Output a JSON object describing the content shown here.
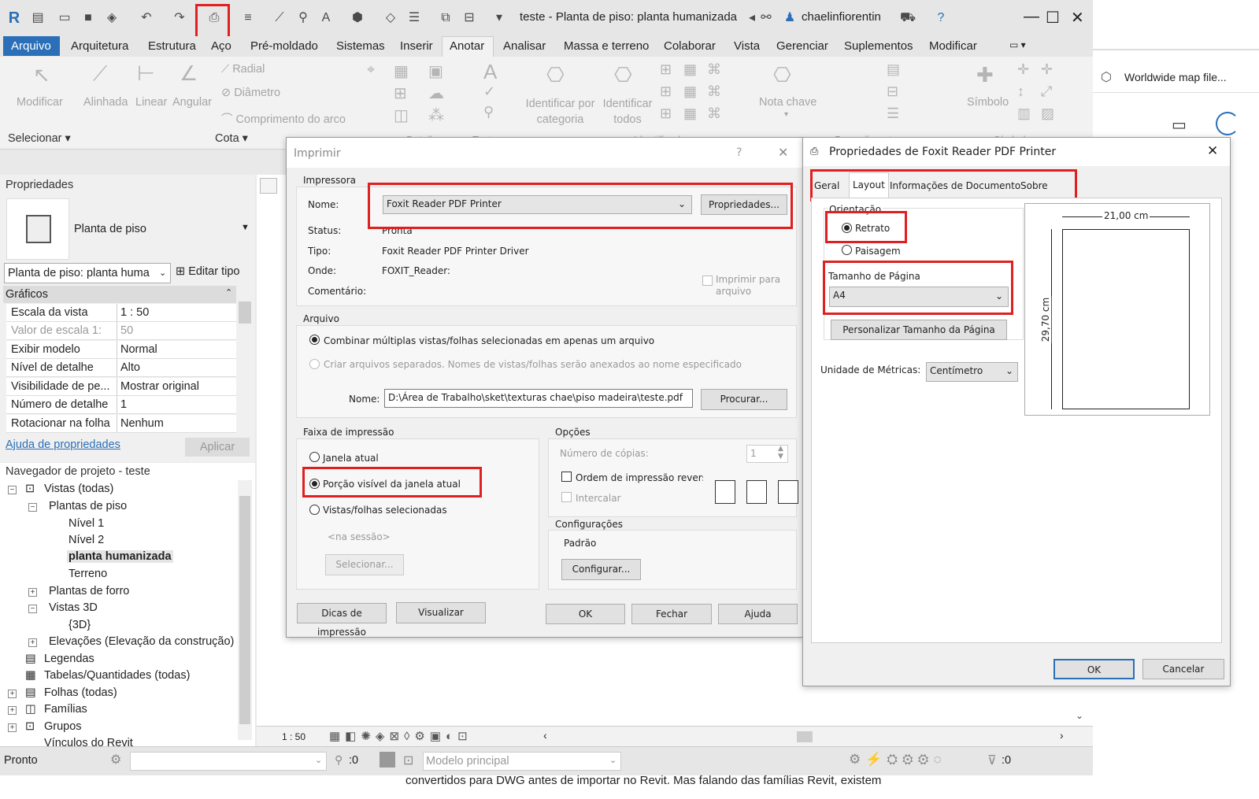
{
  "window": {
    "title": "teste - Planta de piso: planta humanizada",
    "user": "chaelinfiorentin"
  },
  "menu": {
    "items": [
      "Arquivo",
      "Arquitetura",
      "Estrutura",
      "Aço",
      "Pré-moldado",
      "Sistemas",
      "Inserir",
      "Anotar",
      "Analisar",
      "Massa e terreno",
      "Colaborar",
      "Vista",
      "Gerenciar",
      "Suplementos",
      "Modificar"
    ]
  },
  "ribbon": {
    "modificar": "Modificar",
    "selecionar": "Selecionar",
    "alinhada": "Alinhada",
    "linear": "Linear",
    "angular": "Angular",
    "radial": "Radial",
    "diametro": "Diâmetro",
    "comprimento_arco": "Comprimento do arco",
    "cota": "Cota",
    "detalhe": "Detalhe",
    "texto": "Texto",
    "id_categoria": "Identificar por categoria",
    "id_todos": "Identificar todos",
    "identificador": "Identificador",
    "nota_chave": "Nota chave",
    "simbolo": "Símbolo",
    "procedimento": "Procedimento",
    "simbolo_group": "Símbolo"
  },
  "properties": {
    "header": "Propriedades",
    "type_name": "Planta de piso",
    "selector": "Planta de piso: planta huma",
    "edit_type": "Editar tipo",
    "category": "Gráficos",
    "rows": [
      {
        "k": "Escala da vista",
        "v": "1 : 50"
      },
      {
        "k": "Valor de escala    1:",
        "v": "50"
      },
      {
        "k": "Exibir modelo",
        "v": "Normal"
      },
      {
        "k": "Nível de detalhe",
        "v": "Alto"
      },
      {
        "k": "Visibilidade de pe...",
        "v": "Mostrar original"
      },
      {
        "k": "Número de detalhe",
        "v": "1"
      },
      {
        "k": "Rotacionar na folha",
        "v": "Nenhum"
      }
    ],
    "help_link": "Ajuda de propriedades",
    "apply": "Aplicar"
  },
  "navigator": {
    "header": "Navegador de projeto - teste",
    "views_all": "Vistas (todas)",
    "plantas_piso": "Plantas de piso",
    "nivel1": "Nível 1",
    "nivel2": "Nível 2",
    "planta_h": "planta humanizada",
    "terreno": "Terreno",
    "plantas_forro": "Plantas de forro",
    "vistas3d": "Vistas 3D",
    "v3d": "{3D}",
    "elevacoes": "Elevações (Elevação da construção)",
    "legendas": "Legendas",
    "tabelas": "Tabelas/Quantidades (todas)",
    "folhas": "Folhas (todas)",
    "familias": "Famílias",
    "grupos": "Grupos",
    "vinculos": "Vínculos do Revit"
  },
  "viewbar": {
    "scale": "1 : 50"
  },
  "status": {
    "text": "Pronto",
    "coord": ":0",
    "model": "Modelo principal",
    "filter": ":0"
  },
  "print": {
    "title": "Imprimir",
    "printer_section": "Impressora",
    "name_label": "Nome:",
    "printer_name": "Foxit Reader PDF Printer",
    "properties_btn": "Propriedades...",
    "status_label": "Status:",
    "status_val": "Pronta",
    "type_label": "Tipo:",
    "type_val": "Foxit Reader PDF Printer Driver",
    "where_label": "Onde:",
    "where_val": "FOXIT_Reader:",
    "comment_label": "Comentário:",
    "print_to_file": "Imprimir para arquivo",
    "file_section": "Arquivo",
    "combine": "Combinar múltiplas vistas/folhas selecionadas em apenas um arquivo",
    "separate": "Criar arquivos separados. Nomes de vistas/folhas serão anexados ao nome especificado",
    "file_name_label": "Nome:",
    "file_path": "D:\\Área de Trabalho\\sket\\texturas chae\\piso madeira\\teste.pdf",
    "browse_btn": "Procurar...",
    "range_section": "Faixa de impressão",
    "current_window": "Janela atual",
    "visible_portion": "Porção visível da janela atual",
    "selected_views": "Vistas/folhas selecionadas",
    "in_session": "<na sessão>",
    "select_btn": "Selecionar...",
    "options_section": "Opções",
    "copies_label": "Número de cópias:",
    "copies_val": "1",
    "reverse_order": "Ordem de impressão reversa",
    "collate": "Intercalar",
    "settings_section": "Configurações",
    "settings_val": "Padrão",
    "configure_btn": "Configurar...",
    "tips_btn": "Dicas de impressão",
    "preview_btn": "Visualizar",
    "ok_btn": "OK",
    "close_btn": "Fechar",
    "help_btn": "Ajuda",
    "question": "?"
  },
  "foxit": {
    "title": "Propriedades de Foxit Reader PDF Printer",
    "tabs": [
      "Geral",
      "Layout",
      "Informações de Documento",
      "Sobre"
    ],
    "orientation_label": "Orientação",
    "portrait": "Retrato",
    "landscape": "Paisagem",
    "page_size_label": "Tamanho de Página",
    "page_size": "A4",
    "custom_size_btn": "Personalizar Tamanho da Página",
    "units_label": "Unidade de Métricas:",
    "units_val": "Centímetro",
    "width_dim": "21,00 cm",
    "height_dim": "29,70 cm",
    "ok_btn": "OK",
    "cancel_btn": "Cancelar"
  },
  "side": {
    "worldwide": "Worldwide map file..."
  },
  "footer_text": "convertidos para DWG antes de importar no Revit. Mas falando das famílias Revit, existem"
}
